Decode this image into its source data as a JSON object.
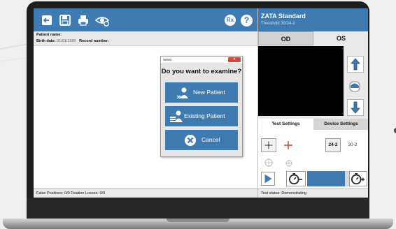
{
  "toolbar": {
    "icons": [
      "exit-icon",
      "save-icon",
      "print-icon",
      "view-icon"
    ],
    "rx_label": "Rx",
    "help_label": "?"
  },
  "patient": {
    "name_label": "Patient name:",
    "birth_label": "Birth date:",
    "birth_value": "01/01/1980",
    "record_label": "Record number:"
  },
  "dialog": {
    "title": "Select",
    "question": "Do you want to examine?",
    "new_patient": "New Patient",
    "existing_patient": "Existing Patient",
    "cancel": "Cancel"
  },
  "status_left": "False Positives: 0/0   Fixation Losses: 0/0",
  "right_panel": {
    "title": "ZATA Standard",
    "subtitle": "Threshold 30/24-2",
    "eye_tabs": [
      "OD",
      "OS"
    ],
    "selected_eye": "OD",
    "settings_tabs": [
      "Test Settings",
      "Device Settings"
    ],
    "selected_settings_tab": "Test Settings",
    "programs": [
      "24-2",
      "30-2"
    ],
    "selected_program": "24-2",
    "status": "Test status: Demonstrating"
  },
  "colors": {
    "accent": "#3f7ab0",
    "panel_bg": "#e9e9e9",
    "close": "#c94a3f",
    "fixation_red": "#d23a2f"
  }
}
